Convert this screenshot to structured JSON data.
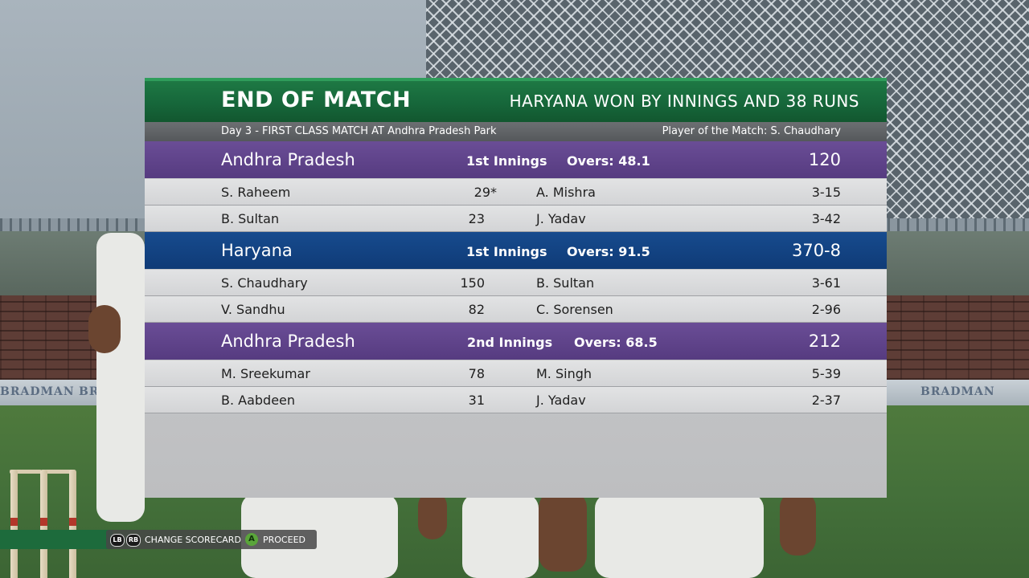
{
  "header": {
    "title": "END OF MATCH",
    "result": "HARYANA WON BY INNINGS AND 38 RUNS"
  },
  "subheader": {
    "match_info": "Day 3 - FIRST CLASS MATCH AT Andhra Pradesh Park",
    "player_of_match": "Player of the Match: S. Chaudhary"
  },
  "innings": [
    {
      "team": "Andhra Pradesh",
      "label": "1st Innings",
      "overs": "Overs: 48.1",
      "score": "120",
      "color": "#5f4489",
      "rows": [
        {
          "batter": "S. Raheem",
          "runs": "29*",
          "bowler": "A. Mishra",
          "figures": "3-15"
        },
        {
          "batter": "B. Sultan",
          "runs": "23",
          "bowler": "J. Yadav",
          "figures": "3-42"
        }
      ]
    },
    {
      "team": "Haryana",
      "label": "1st Innings",
      "overs": "Overs: 91.5",
      "score": "370-8",
      "color": "#134484",
      "rows": [
        {
          "batter": "S. Chaudhary",
          "runs": "150",
          "bowler": "B. Sultan",
          "figures": "3-61"
        },
        {
          "batter": "V. Sandhu",
          "runs": "82",
          "bowler": "C. Sorensen",
          "figures": "2-96"
        }
      ]
    },
    {
      "team": "Andhra Pradesh",
      "label": "2nd Innings",
      "overs": "Overs: 68.5",
      "score": "212",
      "color": "#5f4489",
      "rows": [
        {
          "batter": "M. Sreekumar",
          "runs": "78",
          "bowler": "M. Singh",
          "figures": "5-39"
        },
        {
          "batter": "B. Aabdeen",
          "runs": "31",
          "bowler": "J. Yadav",
          "figures": "2-37"
        }
      ]
    }
  ],
  "controls": {
    "lb": "LB",
    "rb": "RB",
    "change_label": "CHANGE SCORECARD",
    "a": "A",
    "proceed_label": "PROCEED"
  },
  "background": {
    "board_left": "BRADMAN",
    "board_mid": "BRADMAN",
    "board_right": "BRADMAN"
  },
  "colors": {
    "header_green": "#16663a",
    "purple": "#5f4489",
    "blue": "#134484"
  }
}
